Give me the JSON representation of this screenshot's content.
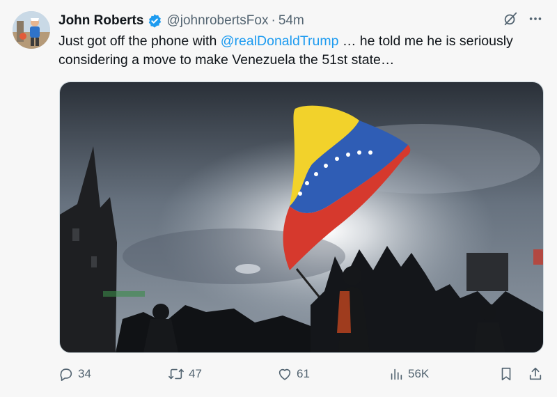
{
  "author": {
    "name": "John Roberts",
    "handle": "@johnrobertsFox",
    "separator": "·",
    "time": "54m"
  },
  "tweet": {
    "text_before": "Just got off the phone with ",
    "mention": "@realDonaldTrump",
    "text_after": " … he told me he is seriously considering a move to make Venezuela the 51st state…"
  },
  "stats": {
    "replies": "34",
    "retweets": "47",
    "likes": "61",
    "views": "56K"
  },
  "icons": {
    "verified": "verified-badge-icon",
    "grok": "grok-icon",
    "more": "more-icon",
    "reply": "reply-icon",
    "retweet": "retweet-icon",
    "like": "heart-icon",
    "views": "views-icon",
    "bookmark": "bookmark-icon",
    "share": "share-icon"
  },
  "colors": {
    "link": "#1d9bf0",
    "verified": "#1d9bf0",
    "secondary_text": "#536471",
    "flag_yellow": "#f2d22b",
    "flag_blue": "#2f5db5",
    "flag_red": "#d6392d"
  }
}
